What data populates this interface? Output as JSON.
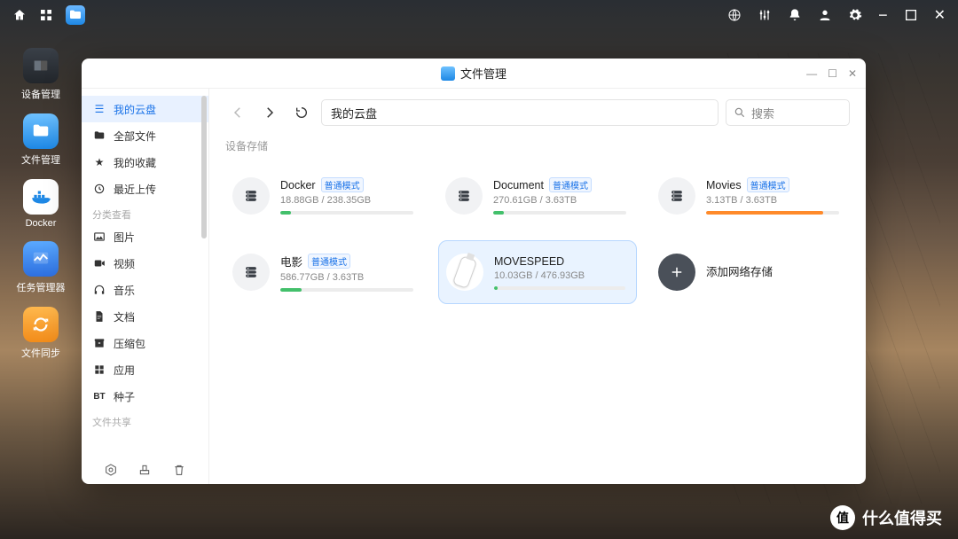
{
  "os_bar": {
    "right_icons": [
      "globe",
      "sliders",
      "bell",
      "user",
      "gear",
      "minimize",
      "maximize",
      "close"
    ]
  },
  "dock": [
    {
      "label": "设备管理",
      "icon": "device"
    },
    {
      "label": "文件管理",
      "icon": "files"
    },
    {
      "label": "Docker",
      "icon": "docker"
    },
    {
      "label": "任务管理器",
      "icon": "task"
    },
    {
      "label": "文件同步",
      "icon": "sync"
    }
  ],
  "window": {
    "title": "文件管理",
    "path": "我的云盘",
    "search_placeholder": "搜索"
  },
  "sidebar": {
    "primary": [
      {
        "label": "我的云盘",
        "glyph": "≡"
      },
      {
        "label": "全部文件",
        "glyph": "folder"
      },
      {
        "label": "我的收藏",
        "glyph": "★"
      },
      {
        "label": "最近上传",
        "glyph": "clock"
      }
    ],
    "section1_label": "分类查看",
    "categories": [
      {
        "label": "图片",
        "glyph": "image"
      },
      {
        "label": "视频",
        "glyph": "video"
      },
      {
        "label": "音乐",
        "glyph": "audio"
      },
      {
        "label": "文档",
        "glyph": "doc"
      },
      {
        "label": "压缩包",
        "glyph": "zip"
      },
      {
        "label": "应用",
        "glyph": "apps"
      },
      {
        "label": "种子",
        "glyph": "BT",
        "prefix": "BT"
      }
    ],
    "section2_label": "文件共享"
  },
  "main": {
    "section_label": "设备存储",
    "badge_text": "普通模式",
    "add_label": "添加网络存储",
    "items": [
      {
        "name": "Docker",
        "size": "18.88GB / 238.35GB",
        "pct": 8,
        "color": "green",
        "badge": true
      },
      {
        "name": "Document",
        "size": "270.61GB / 3.63TB",
        "pct": 8,
        "color": "green",
        "badge": true
      },
      {
        "name": "Movies",
        "size": "3.13TB / 3.63TB",
        "pct": 88,
        "color": "orange",
        "badge": true
      },
      {
        "name": "电影",
        "size": "586.77GB / 3.63TB",
        "pct": 16,
        "color": "green",
        "badge": true
      },
      {
        "name": "MOVESPEED",
        "size": "10.03GB / 476.93GB",
        "pct": 3,
        "color": "green",
        "badge": false,
        "usb": true,
        "selected": true
      }
    ]
  },
  "watermark": {
    "logo": "值",
    "text": "什么值得买"
  }
}
